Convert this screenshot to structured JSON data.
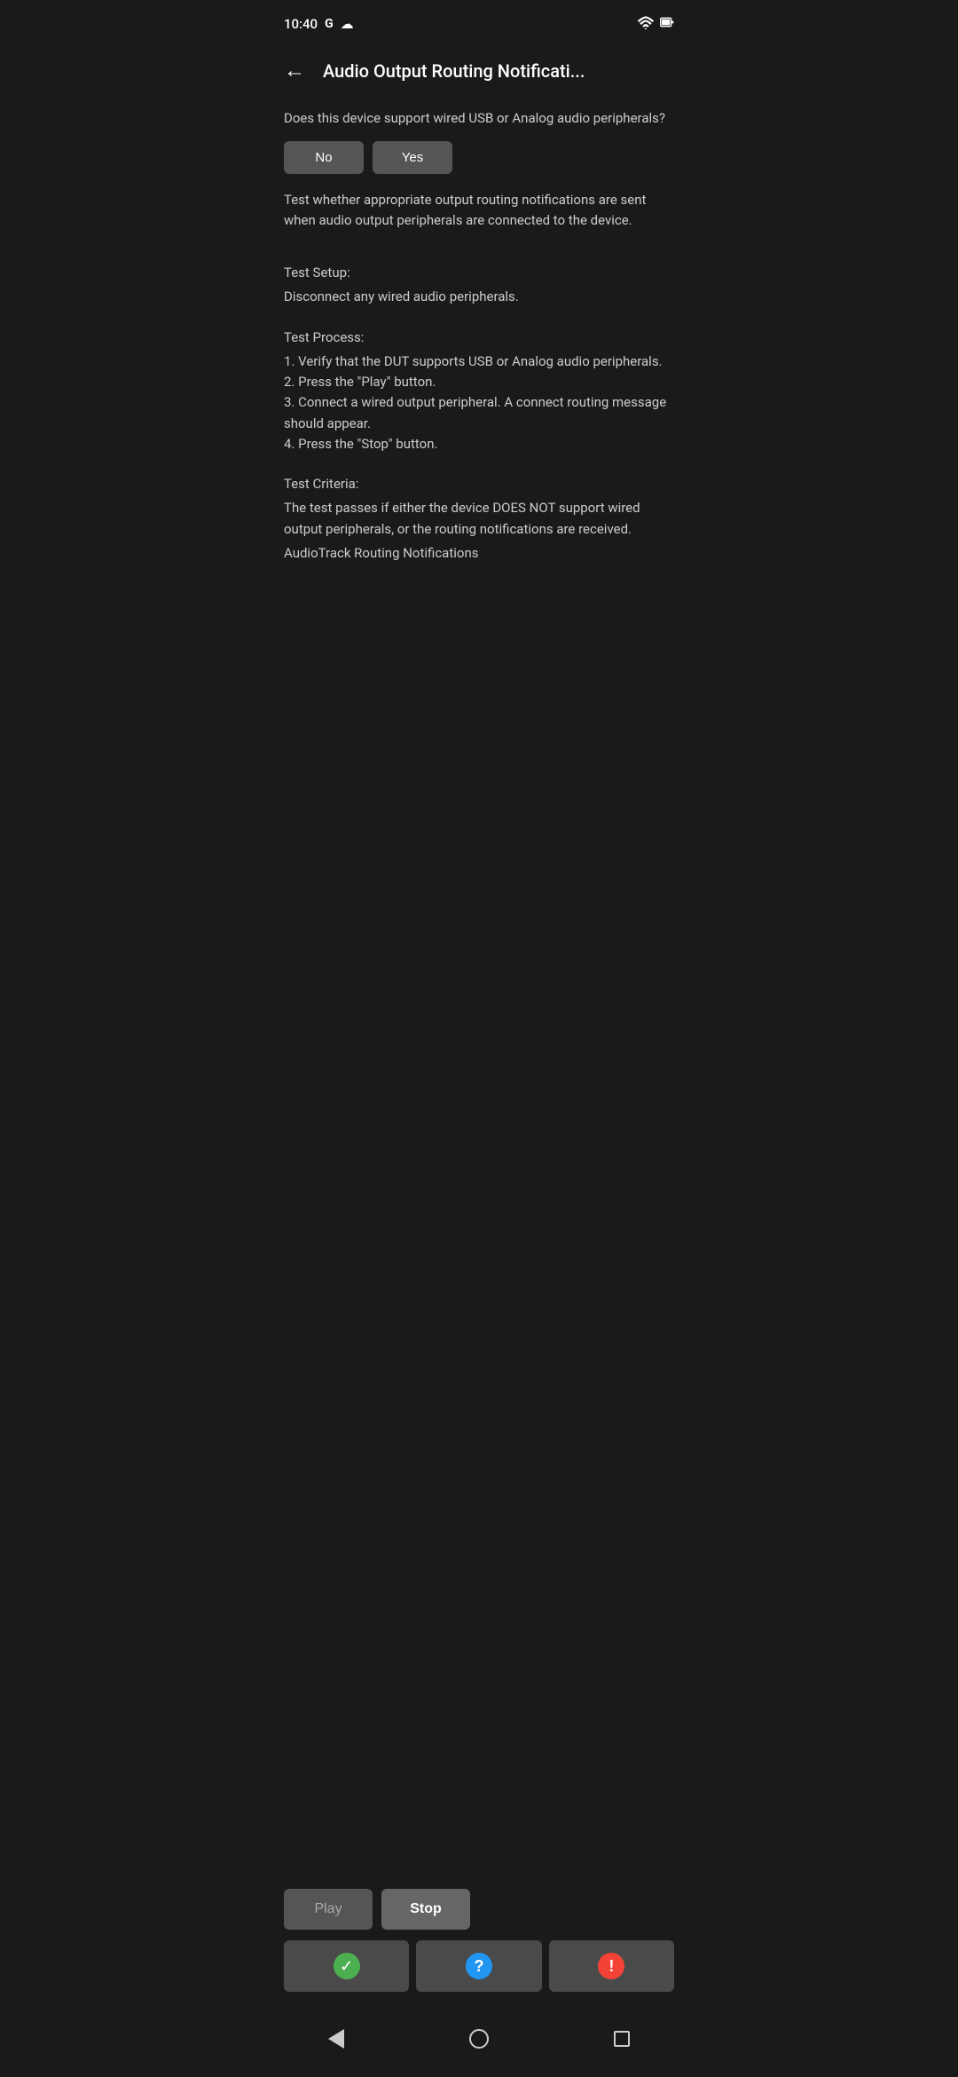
{
  "statusBar": {
    "time": "10:40",
    "googleIcon": "G",
    "cloudIcon": "☁"
  },
  "toolbar": {
    "backLabel": "←",
    "title": "Audio Output Routing Notificati..."
  },
  "content": {
    "question": "Does this device support wired USB or Analog audio peripherals?",
    "noLabel": "No",
    "yesLabel": "Yes",
    "description": "Test whether appropriate output routing notifications are sent when audio output peripherals are connected to the device.",
    "testSetupLabel": "Test Setup:",
    "testSetupText": "Disconnect any wired audio peripherals.",
    "testProcessLabel": "Test Process:",
    "testProcessSteps": "1. Verify that the DUT supports USB or Analog audio peripherals.\n2. Press the \"Play\" button.\n3. Connect a wired output peripheral. A connect routing message should appear.\n4. Press the \"Stop\" button.",
    "testCriteriaLabel": "Test Criteria:",
    "testCriteriaText": "The test passes if either the device DOES NOT support wired output peripherals, or the routing notifications are received.",
    "audioTrackLabel": "AudioTrack Routing Notifications"
  },
  "controls": {
    "playLabel": "Play",
    "stopLabel": "Stop"
  },
  "resultButtons": {
    "passIcon": "✓",
    "infoIcon": "?",
    "failIcon": "!"
  },
  "navBar": {
    "backTitle": "back",
    "homeTitle": "home",
    "recentTitle": "recent"
  }
}
